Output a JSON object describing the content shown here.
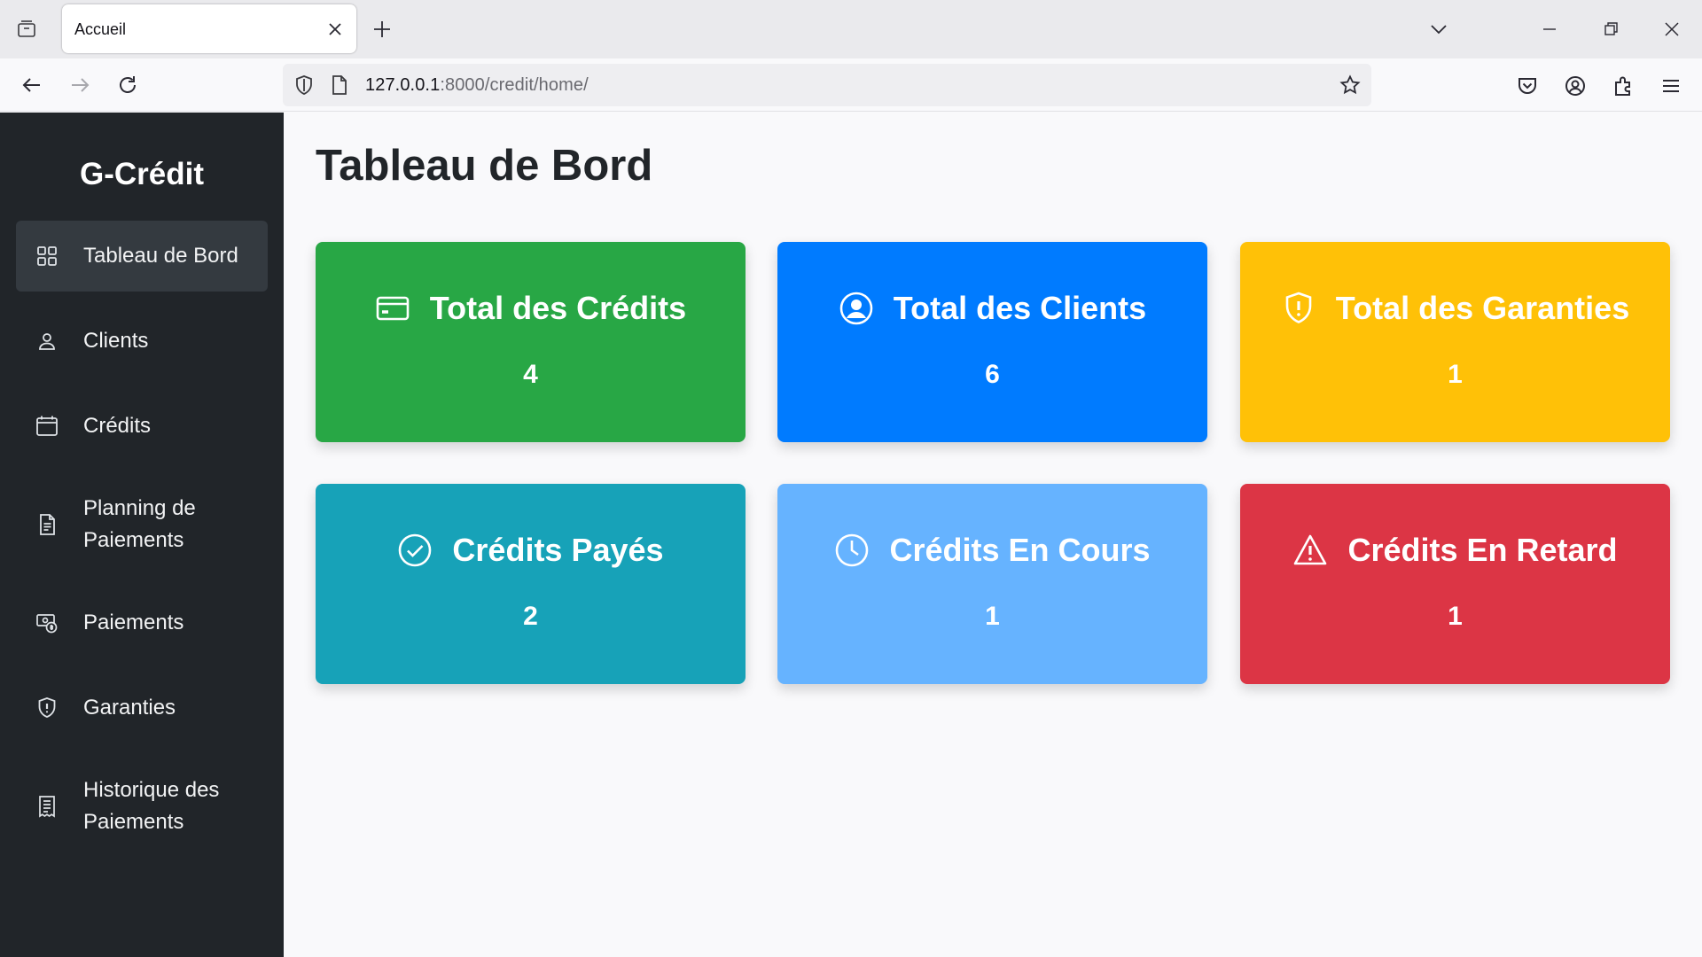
{
  "browser": {
    "tab_title": "Accueil",
    "url_host": "127.0.0.1",
    "url_rest": ":8000/credit/home/"
  },
  "app": {
    "brand": "G-Crédit",
    "sidebar": {
      "items": [
        {
          "label": "Tableau de Bord",
          "icon": "grid-icon",
          "active": true
        },
        {
          "label": "Clients",
          "icon": "person-icon"
        },
        {
          "label": "Crédits",
          "icon": "calendar-icon"
        },
        {
          "label": "Planning de Paiements",
          "icon": "document-icon"
        },
        {
          "label": "Paiements",
          "icon": "cash-coin-icon"
        },
        {
          "label": "Garanties",
          "icon": "shield-icon"
        },
        {
          "label": "Historique des Paiements",
          "icon": "receipt-icon"
        }
      ]
    },
    "page_title": "Tableau de Bord",
    "cards": [
      {
        "title": "Total des Crédits",
        "value": "4",
        "icon": "credit-card-icon",
        "color": "#28a745"
      },
      {
        "title": "Total des Clients",
        "value": "6",
        "icon": "person-circle-icon",
        "color": "#007bff"
      },
      {
        "title": "Total des Garanties",
        "value": "1",
        "icon": "shield-exclamation-icon",
        "color": "#ffc107"
      },
      {
        "title": "Crédits Payés",
        "value": "2",
        "icon": "check-circle-icon",
        "color": "#17a2b8"
      },
      {
        "title": "Crédits En Cours",
        "value": "1",
        "icon": "clock-icon",
        "color": "#66b3ff"
      },
      {
        "title": "Crédits En Retard",
        "value": "1",
        "icon": "warning-triangle-icon",
        "color": "#dc3545"
      }
    ]
  }
}
